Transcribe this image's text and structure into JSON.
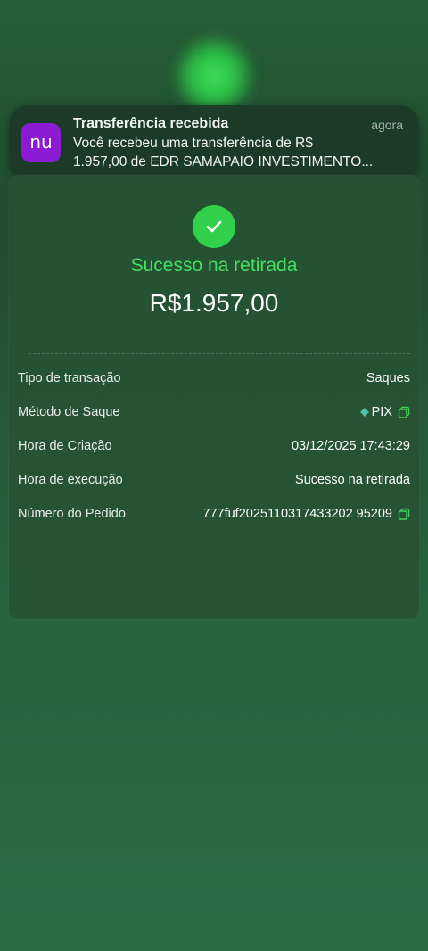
{
  "notification": {
    "app_icon_text": "nu",
    "title": "Transferência recebida",
    "time": "agora",
    "body_line1": "Você recebeu uma transferência de R$",
    "body_line2": "1.957,00 de EDR SAMAPAIO INVESTIMENTO..."
  },
  "status": {
    "title": "Sucesso na retirada",
    "amount": "R$1.957,00"
  },
  "details": [
    {
      "label": "Tipo de transação",
      "value": "Saques"
    },
    {
      "label": "Método de Saque",
      "value": "PIX"
    },
    {
      "label": "Hora de Criação",
      "value": "03/12/2025 17:43:29"
    },
    {
      "label": "Hora de execução",
      "value": "Sucesso na retirada"
    },
    {
      "label": "Número do Pedido",
      "value": "777fuf2025110317433202 95209"
    }
  ],
  "colors": {
    "accent_green": "#44e060",
    "check_green": "#31d14c",
    "nubank_purple": "#8a1bd2"
  },
  "icons": [
    "nubank-logo-icon",
    "checkmark-icon",
    "pix-icon",
    "copy-icon"
  ]
}
